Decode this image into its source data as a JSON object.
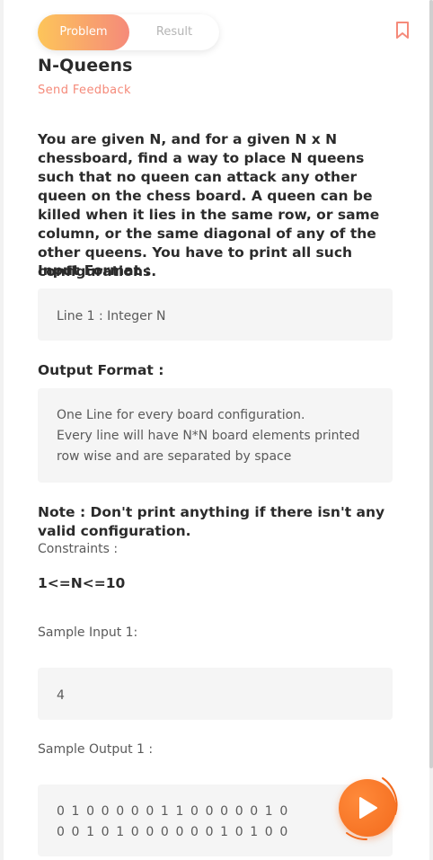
{
  "tabs": {
    "problem": "Problem",
    "result": "Result"
  },
  "problem": {
    "title": "N-Queens",
    "feedback": "Send Feedback",
    "description": "You are given N, and for a given N x N chessboard, find a way to place N queens such that no queen can attack any other queen on the chess board. A queen can be killed when it lies in the same row, or same column, or the same diagonal of any of the other queens. You have to print all such configurations.",
    "input_format_label": "Input Format :",
    "input_format": "Line 1 : Integer N",
    "output_format_label": "Output Format :",
    "output_format": [
      "One Line for every board configuration.",
      "Every line will have N*N board elements printed",
      "row wise and are separated by space"
    ],
    "note": "Note : Don't print anything if there isn't any valid configuration.",
    "constraints_label": "Constraints :",
    "constraints": "1<=N<=10",
    "sample_input_label": "Sample Input 1:",
    "sample_input": "4",
    "sample_output_label": "Sample Output 1 :",
    "sample_output": [
      "0 1 0 0 0 0 0 1 1 0 0 0 0 0 1 0",
      "0 0 1 0 1 0 0 0 0 0 0 1 0 1 0 0"
    ]
  },
  "colors": {
    "accent": "#f58a7a",
    "run": "#f36a1c",
    "tab_gradient_start": "#fdc55a"
  },
  "icons": {
    "bookmark": "bookmark-icon",
    "run": "play-icon"
  }
}
